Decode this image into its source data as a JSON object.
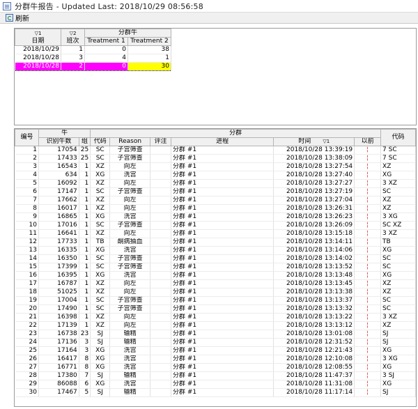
{
  "window": {
    "title": "分群牛报告 - Updated Last: 2018/10/29 08:56:58"
  },
  "toolbar": {
    "refresh_label": "刷新"
  },
  "summary": {
    "headers": {
      "date": "日期",
      "date_sort": "▽1",
      "shift": "班次",
      "shift_sort": "▽2",
      "group": "分群牛",
      "t1": "Treatment 1",
      "t2": "Treatment 2"
    },
    "rows": [
      {
        "date": "2018/10/29",
        "shift": "1",
        "t1": "0",
        "t2": "38"
      },
      {
        "date": "2018/10/28",
        "shift": "3",
        "t1": "4",
        "t2": "1"
      },
      {
        "date": "2018/10/28",
        "shift": "2",
        "t1": "0",
        "t2": "30"
      }
    ]
  },
  "detail": {
    "headers": {
      "num": "编号",
      "cow_group": "牛",
      "id": "识别牛数",
      "grp": "组",
      "sort_group": "分群",
      "code": "代码",
      "reason": "Reason",
      "note": "评注",
      "procedure": "进程",
      "time": "时间",
      "time_sort": "▽1",
      "prev": "以前",
      "code2": "代码"
    },
    "rows": [
      [
        "1",
        "17054",
        "25",
        "SC",
        "子宫筛查",
        "",
        "分群 #1",
        "2018/10/28 13:39:19",
        "¦",
        "7 SC"
      ],
      [
        "2",
        "17433",
        "25",
        "SC",
        "子宫筛查",
        "",
        "分群 #1",
        "2018/10/28 13:38:09",
        "¦",
        "7 SC"
      ],
      [
        "3",
        "16543",
        "1",
        "XZ",
        "向左",
        "",
        "分群 #1",
        "2018/10/28 13:27:54",
        "¦",
        "XZ"
      ],
      [
        "4",
        "634",
        "1",
        "XG",
        "洗宫",
        "",
        "分群 #1",
        "2018/10/28 13:27:40",
        "¦",
        "XG"
      ],
      [
        "5",
        "16092",
        "1",
        "XZ",
        "向左",
        "",
        "分群 #1",
        "2018/10/28 13:27:27",
        "¦",
        "3 XZ"
      ],
      [
        "6",
        "17147",
        "1",
        "SC",
        "子宫筛查",
        "",
        "分群 #1",
        "2018/10/28 13:27:19",
        "¦",
        "SC"
      ],
      [
        "7",
        "17662",
        "1",
        "XZ",
        "向左",
        "",
        "分群 #1",
        "2018/10/28 13:27:04",
        "¦",
        "XZ"
      ],
      [
        "8",
        "16017",
        "1",
        "XZ",
        "向左",
        "",
        "分群 #1",
        "2018/10/28 13:26:31",
        "¦",
        "XZ"
      ],
      [
        "9",
        "16865",
        "1",
        "XG",
        "洗宫",
        "",
        "分群 #1",
        "2018/10/28 13:26:23",
        "¦",
        "3 XG"
      ],
      [
        "10",
        "17016",
        "1",
        "SC",
        "子宫筛查",
        "",
        "分群 #1",
        "2018/10/28 13:26:09",
        "¦",
        "SC XZ"
      ],
      [
        "11",
        "16641",
        "1",
        "XZ",
        "向左",
        "",
        "分群 #1",
        "2018/10/28 13:15:18",
        "¦",
        "3 XZ"
      ],
      [
        "12",
        "17733",
        "1",
        "TB",
        "酮病抽血",
        "",
        "分群 #1",
        "2018/10/28 13:14:11",
        "¦",
        "TB"
      ],
      [
        "13",
        "16335",
        "1",
        "XG",
        "洗宫",
        "",
        "分群 #1",
        "2018/10/28 13:14:06",
        "¦",
        "XG"
      ],
      [
        "14",
        "16350",
        "1",
        "SC",
        "子宫筛查",
        "",
        "分群 #1",
        "2018/10/28 13:14:02",
        "¦",
        "SC"
      ],
      [
        "15",
        "17399",
        "1",
        "SC",
        "子宫筛查",
        "",
        "分群 #1",
        "2018/10/28 13:13:52",
        "¦",
        "SC"
      ],
      [
        "16",
        "16395",
        "1",
        "XG",
        "洗宫",
        "",
        "分群 #1",
        "2018/10/28 13:13:48",
        "¦",
        "XG"
      ],
      [
        "17",
        "16787",
        "1",
        "XZ",
        "向左",
        "",
        "分群 #1",
        "2018/10/28 13:13:45",
        "¦",
        "XZ"
      ],
      [
        "18",
        "51025",
        "1",
        "XZ",
        "向左",
        "",
        "分群 #1",
        "2018/10/28 13:13:38",
        "¦",
        "XZ"
      ],
      [
        "19",
        "17004",
        "1",
        "SC",
        "子宫筛查",
        "",
        "分群 #1",
        "2018/10/28 13:13:37",
        "¦",
        "SC"
      ],
      [
        "20",
        "17490",
        "1",
        "SC",
        "子宫筛查",
        "",
        "分群 #1",
        "2018/10/28 13:13:32",
        "¦",
        "SC"
      ],
      [
        "21",
        "16398",
        "1",
        "XZ",
        "向左",
        "",
        "分群 #1",
        "2018/10/28 13:13:22",
        "¦",
        "3 XZ"
      ],
      [
        "22",
        "17139",
        "1",
        "XZ",
        "向左",
        "",
        "分群 #1",
        "2018/10/28 13:13:12",
        "¦",
        "XZ"
      ],
      [
        "23",
        "16738",
        "23",
        "SJ",
        "输精",
        "",
        "分群 #1",
        "2018/10/28 13:01:08",
        "¦",
        "SJ"
      ],
      [
        "24",
        "17136",
        "3",
        "SJ",
        "输精",
        "",
        "分群 #1",
        "2018/10/28 12:31:52",
        "¦",
        "SJ"
      ],
      [
        "25",
        "17164",
        "3",
        "XG",
        "洗宫",
        "",
        "分群 #1",
        "2018/10/28 12:21:43",
        "¦",
        "XG"
      ],
      [
        "26",
        "16417",
        "8",
        "XG",
        "洗宫",
        "",
        "分群 #1",
        "2018/10/28 12:10:08",
        "¦",
        "3 XG"
      ],
      [
        "27",
        "16771",
        "8",
        "XG",
        "洗宫",
        "",
        "分群 #1",
        "2018/10/28 12:08:55",
        "¦",
        "XG"
      ],
      [
        "28",
        "17380",
        "7",
        "SJ",
        "输精",
        "",
        "分群 #1",
        "2018/10/28 11:47:37",
        "¦",
        "3 SJ"
      ],
      [
        "29",
        "86088",
        "6",
        "XG",
        "洗宫",
        "",
        "分群 #1",
        "2018/10/28 11:31:08",
        "¦",
        "XG"
      ],
      [
        "30",
        "17467",
        "5",
        "SJ",
        "输精",
        "",
        "分群 #1",
        "2018/10/28 11:17:14",
        "¦",
        "SJ"
      ]
    ]
  }
}
